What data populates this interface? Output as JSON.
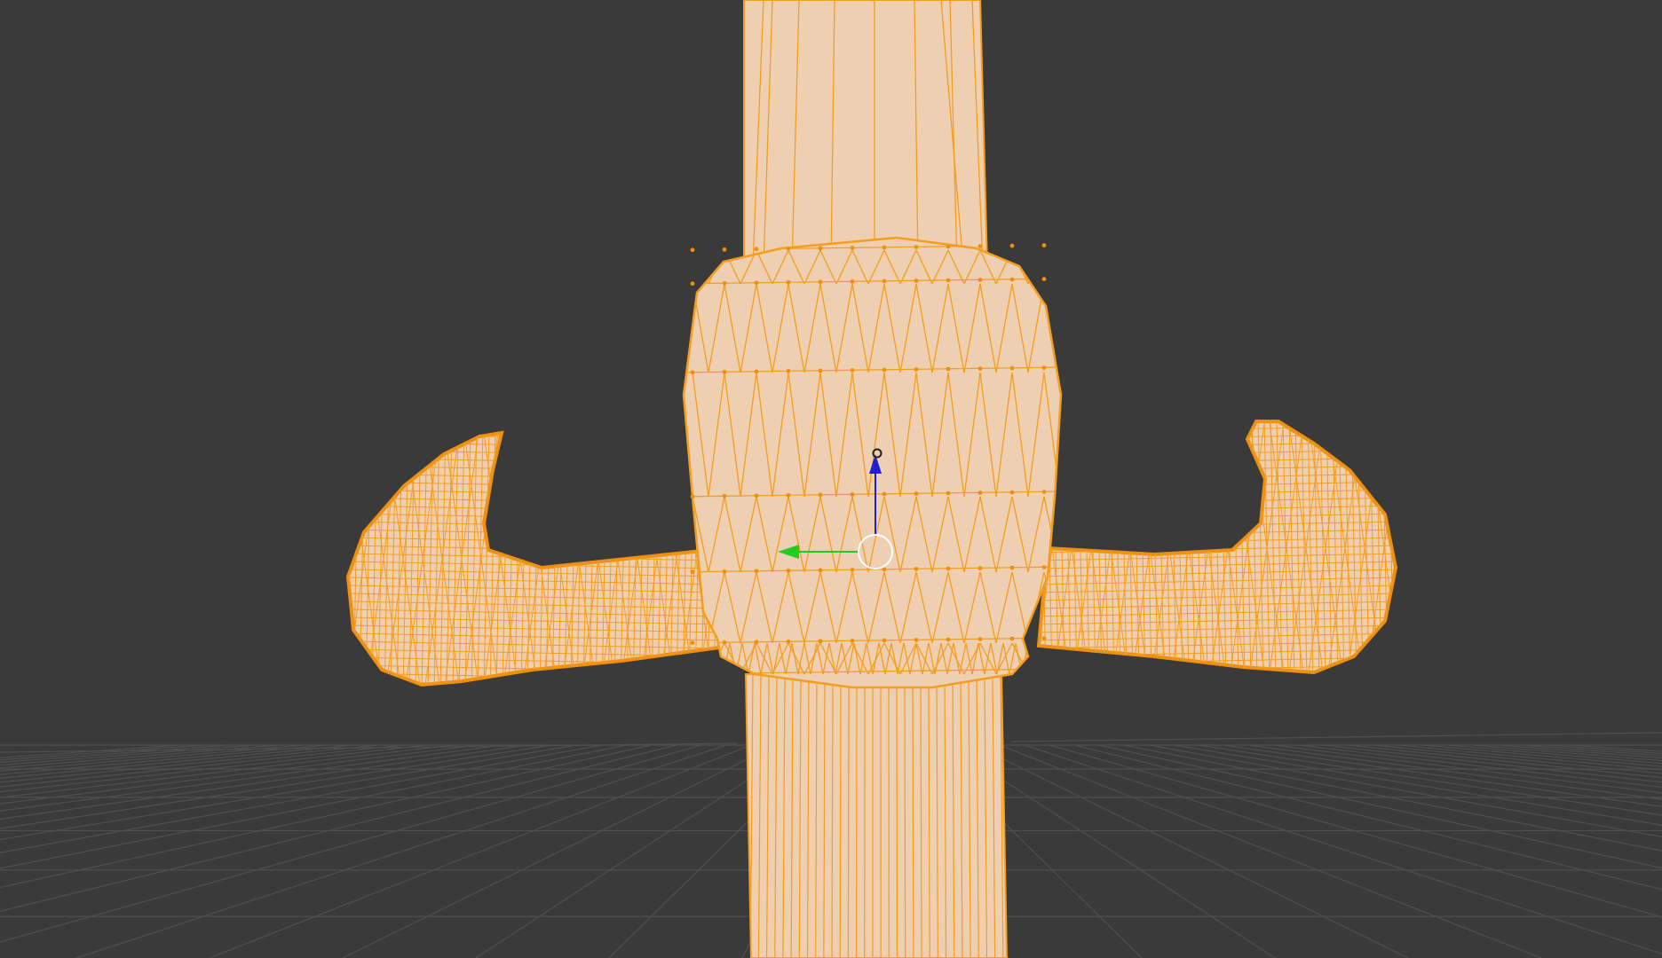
{
  "viewport": {
    "background_color": "#3a3a3a",
    "grid_color": "#4f4f4f",
    "mode": "edit",
    "shading": "solid"
  },
  "object": {
    "description_icon": "sword-hilt-mesh",
    "face_color": "#eecfb1",
    "wire_color": "#f59d1c",
    "vertex_color": "#ef8f10",
    "selected": true
  },
  "gizmo": {
    "z_axis_color": "#2020d0",
    "y_axis_color": "#22cc22",
    "pivot_ring_color": "#ffffff"
  }
}
